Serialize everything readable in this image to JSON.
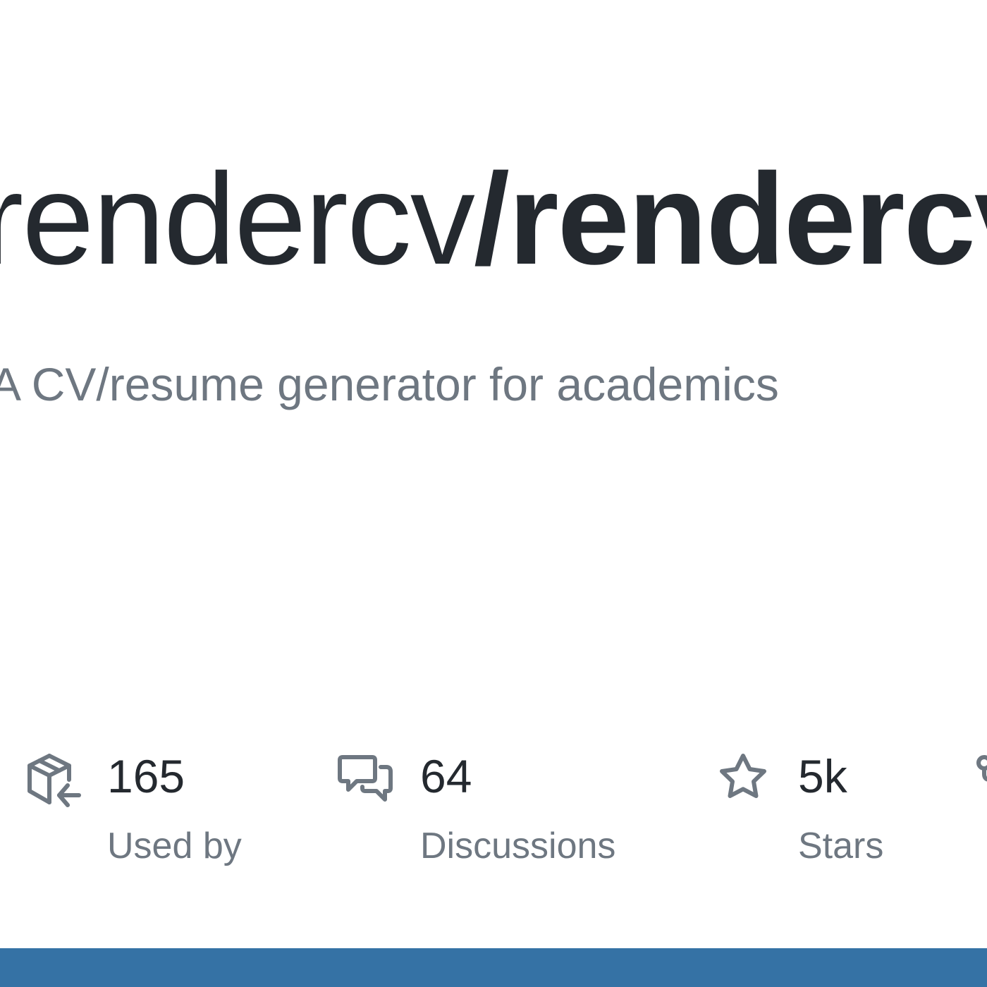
{
  "repo": {
    "owner": "rendercv",
    "separator": "/",
    "name": "rendercv",
    "description": "A CV/resume generator for academics"
  },
  "stats": [
    {
      "icon": "package-dependents-icon",
      "value": "165",
      "label": "Used by"
    },
    {
      "icon": "comment-discussion-icon",
      "value": "64",
      "label": "Discussions"
    },
    {
      "icon": "star-icon",
      "value": "5k",
      "label": "Stars"
    },
    {
      "icon": "repo-forked-icon"
    }
  ],
  "colors": {
    "text_primary": "#24292f",
    "text_secondary": "#6e7781",
    "icon": "#6e7781",
    "language_bar": "#3572a5"
  }
}
